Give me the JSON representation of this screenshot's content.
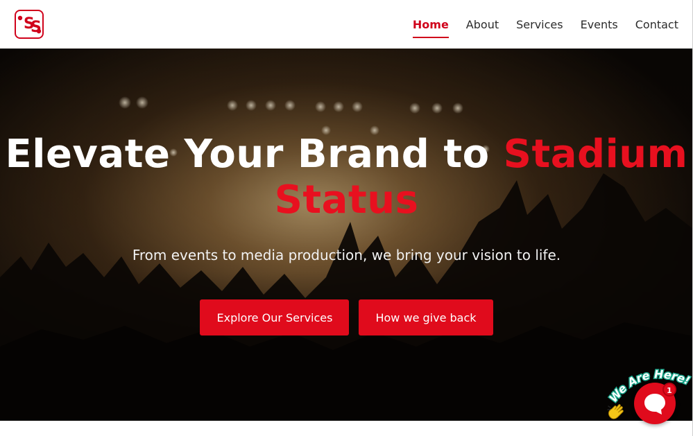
{
  "brand": {
    "logo_icon": "stadium-status-logo-icon",
    "color": "#d0021b"
  },
  "nav": {
    "items": [
      {
        "label": "Home",
        "active": true
      },
      {
        "label": "About",
        "active": false
      },
      {
        "label": "Services",
        "active": false
      },
      {
        "label": "Events",
        "active": false
      },
      {
        "label": "Contact",
        "active": false
      }
    ]
  },
  "hero": {
    "title_main": "Elevate Your Brand to ",
    "title_accent": "Stadium Status",
    "subtitle": "From events to media production, we bring your vision to life.",
    "buttons": [
      {
        "label": "Explore Our Services"
      },
      {
        "label": "How we give back"
      }
    ],
    "background": "concert-crowd-image"
  },
  "chat": {
    "tagline": "We Are Here!",
    "badge_count": "1",
    "icons": [
      "waving-hand-icon",
      "chat-bubble-icon"
    ]
  },
  "colors": {
    "accent": "#e00b1c",
    "text_dark": "#2b2b2b",
    "white": "#ffffff"
  }
}
